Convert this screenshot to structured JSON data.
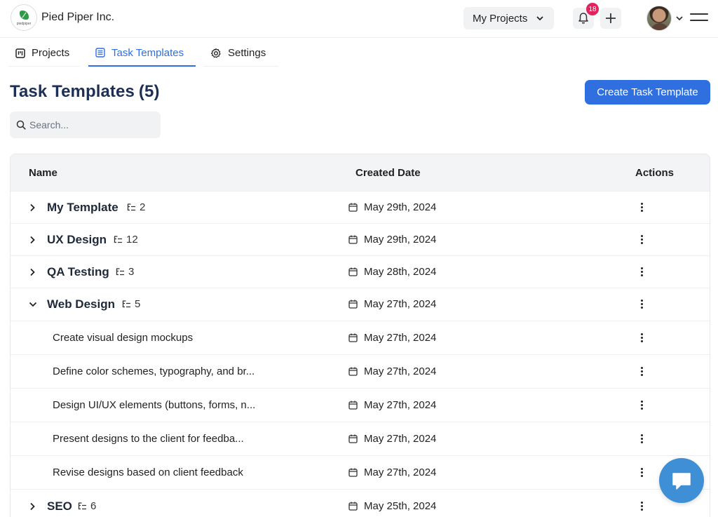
{
  "header": {
    "company_name": "Pied Piper Inc.",
    "logo_text": "piedpiper",
    "projects_dropdown": "My Projects",
    "notification_count": "18"
  },
  "tabs": [
    {
      "label": "Projects",
      "icon": "kanban-icon",
      "active": false
    },
    {
      "label": "Task Templates",
      "icon": "list-icon",
      "active": true
    },
    {
      "label": "Settings",
      "icon": "gear-icon",
      "active": false
    }
  ],
  "page": {
    "title": "Task Templates",
    "count": "(5)",
    "create_button": "Create Task Template",
    "search_placeholder": "Search..."
  },
  "table": {
    "columns": {
      "name": "Name",
      "created": "Created Date",
      "actions": "Actions"
    },
    "rows": [
      {
        "name": "My Template",
        "subtasks": "2",
        "date": "May 29th, 2024",
        "expanded": false
      },
      {
        "name": "UX Design",
        "subtasks": "12",
        "date": "May 29th, 2024",
        "expanded": false
      },
      {
        "name": "QA Testing",
        "subtasks": "3",
        "date": "May 28th, 2024",
        "expanded": false
      },
      {
        "name": "Web Design",
        "subtasks": "5",
        "date": "May 27th, 2024",
        "expanded": true
      },
      {
        "name": "Create visual design mockups",
        "date": "May 27th, 2024"
      },
      {
        "name": "Define color schemes, typography, and br...",
        "date": "May 27th, 2024"
      },
      {
        "name": "Design UI/UX elements (buttons, forms, n...",
        "date": "May 27th, 2024"
      },
      {
        "name": "Present designs to the client for feedba...",
        "date": "May 27th, 2024"
      },
      {
        "name": "Revise designs based on client feedback",
        "date": "May 27th, 2024"
      },
      {
        "name": "SEO",
        "subtasks": "6",
        "date": "May 25th, 2024",
        "expanded": false
      }
    ]
  },
  "colors": {
    "primary": "#2f6fe0",
    "title": "#1d2f55",
    "badge": "#e0245e",
    "chat": "#3f8fd6"
  }
}
